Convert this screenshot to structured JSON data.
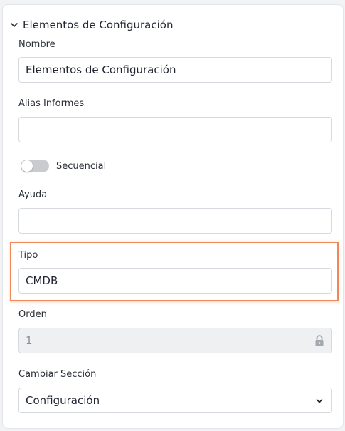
{
  "section": {
    "title": "Elementos de Configuración",
    "icon": "chevron-down-icon"
  },
  "fields": {
    "nombre": {
      "label": "Nombre",
      "value": "Elementos de Configuración"
    },
    "alias": {
      "label": "Alias Informes",
      "value": ""
    },
    "secuencial": {
      "label": "Secuencial",
      "on": false
    },
    "ayuda": {
      "label": "Ayuda",
      "value": ""
    },
    "tipo": {
      "label": "Tipo",
      "value": "CMDB"
    },
    "orden": {
      "label": "Orden",
      "value": "1",
      "locked": true,
      "icon": "lock-icon"
    },
    "cambiar_seccion": {
      "label": "Cambiar Sección",
      "value": "Configuración",
      "icon": "chevron-down-icon"
    }
  },
  "colors": {
    "highlight": "#f0895a",
    "toggle_off": "#c9cbcf"
  }
}
